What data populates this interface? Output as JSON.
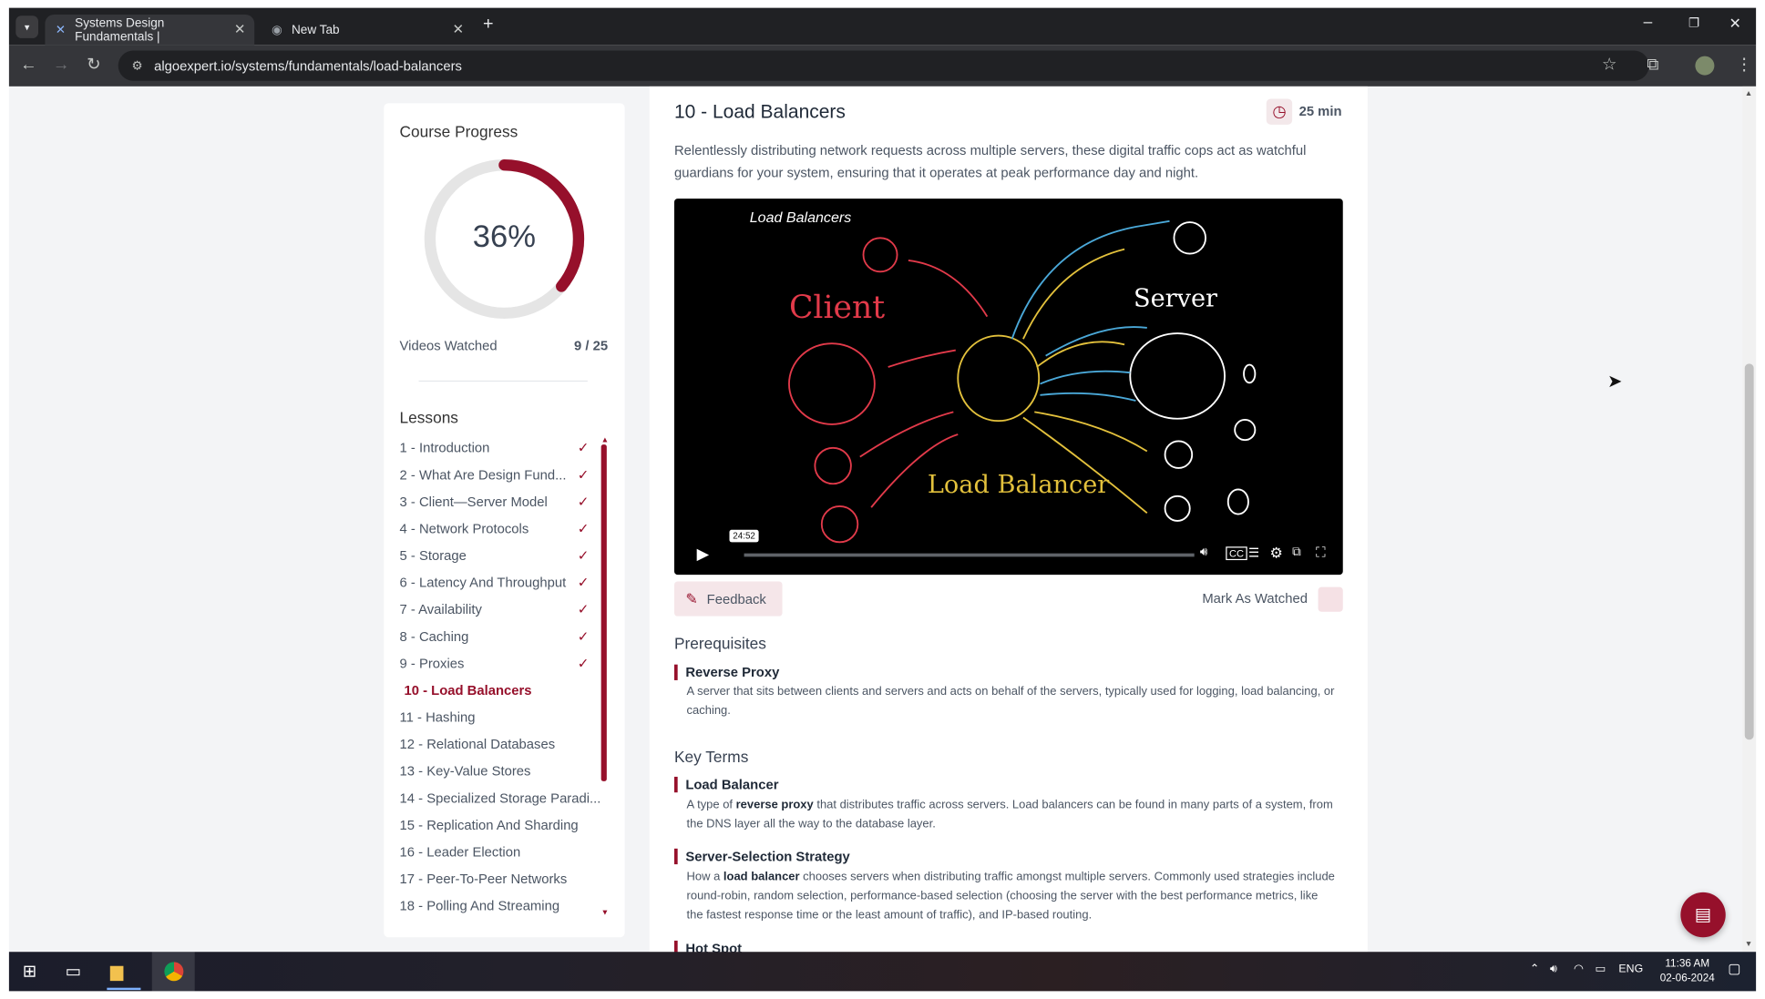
{
  "browser": {
    "tabs": [
      {
        "title": "Systems Design Fundamentals |",
        "active": true
      },
      {
        "title": "New Tab",
        "active": false
      }
    ],
    "url": "algoexpert.io/systems/fundamentals/load-balancers"
  },
  "sidebar": {
    "progress_title": "Course Progress",
    "progress_percent": "36%",
    "progress_fraction": 0.36,
    "videos_watched_label": "Videos Watched",
    "videos_watched_value": "9 / 25",
    "lessons_title": "Lessons",
    "lessons": [
      {
        "label": "1 - Introduction",
        "done": true
      },
      {
        "label": "2 - What Are Design Fund...",
        "done": true
      },
      {
        "label": "3 - Client—Server Model",
        "done": true
      },
      {
        "label": "4 - Network Protocols",
        "done": true
      },
      {
        "label": "5 - Storage",
        "done": true
      },
      {
        "label": "6 - Latency And Throughput",
        "done": true
      },
      {
        "label": "7 - Availability",
        "done": true
      },
      {
        "label": "8 - Caching",
        "done": true
      },
      {
        "label": "9 - Proxies",
        "done": true
      },
      {
        "label": "10 - Load Balancers",
        "done": false,
        "current": true
      },
      {
        "label": "11 - Hashing",
        "done": false
      },
      {
        "label": "12 - Relational Databases",
        "done": false
      },
      {
        "label": "13 - Key-Value Stores",
        "done": false
      },
      {
        "label": "14 - Specialized Storage Paradi...",
        "done": false
      },
      {
        "label": "15 - Replication And Sharding",
        "done": false
      },
      {
        "label": "16 - Leader Election",
        "done": false
      },
      {
        "label": "17 - Peer-To-Peer Networks",
        "done": false
      },
      {
        "label": "18 - Polling And Streaming",
        "done": false
      }
    ]
  },
  "main": {
    "title": "10 - Load Balancers",
    "duration": "25 min",
    "description": "Relentlessly distributing network requests across multiple servers, these digital traffic cops act as watchful guardians for your system, ensuring that it operates at peak performance day and night.",
    "video": {
      "title_text": "Load Balancers",
      "label_client": "Client",
      "label_server": "Server",
      "label_lb": "Load Balancer",
      "time_tooltip": "24:52"
    },
    "feedback_label": "Feedback",
    "mark_watched_label": "Mark As Watched",
    "prerequisites_title": "Prerequisites",
    "prerequisites": [
      {
        "term": "Reverse Proxy",
        "desc": "A server that sits between clients and servers and acts on behalf of the servers, typically used for logging, load balancing, or caching."
      }
    ],
    "key_terms_title": "Key Terms",
    "key_terms": [
      {
        "term": "Load Balancer",
        "desc_pre": "A type of ",
        "desc_bold": "reverse proxy",
        "desc_post": " that distributes traffic across servers. Load balancers can be found in many parts of a system, from the DNS layer all the way to the database layer."
      },
      {
        "term": "Server-Selection Strategy",
        "desc_pre": "How a ",
        "desc_bold": "load balancer",
        "desc_post": " chooses servers when distributing traffic amongst multiple servers. Commonly used strategies include round-robin, random selection, performance-based selection (choosing the server with the best performance metrics, like the fastest response time or the least amount of traffic), and IP-based routing."
      },
      {
        "term": "Hot Spot",
        "desc_pre": "",
        "desc_bold": "",
        "desc_post": ""
      }
    ]
  },
  "taskbar": {
    "lang": "ENG",
    "time": "11:36 AM",
    "date": "02-06-2024"
  },
  "colors": {
    "accent": "#96102b"
  }
}
